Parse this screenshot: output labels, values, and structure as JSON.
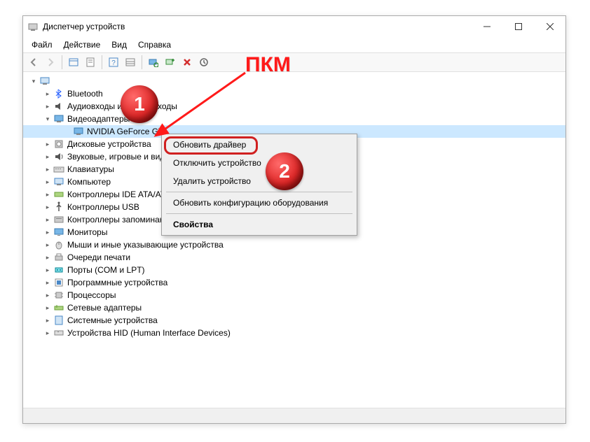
{
  "window": {
    "title": "Диспетчер устройств"
  },
  "menu": {
    "file": "Файл",
    "action": "Действие",
    "view": "Вид",
    "help": "Справка"
  },
  "tree": {
    "root": "",
    "bluetooth": "Bluetooth",
    "audio": "Аудиовходы и аудиовыходы",
    "video": "Видеоадаптеры",
    "nvidia": "NVIDIA GeForce GT",
    "disk": "Дисковые устройства",
    "sound_game": "Звуковые, игровые и видеоустройства",
    "keyboards": "Клавиатуры",
    "computer": "Компьютер",
    "ide": "Контроллеры IDE ATA/ATAPI",
    "usb": "Контроллеры USB",
    "storage": "Контроллеры запоминающих устройств",
    "monitors": "Мониторы",
    "mice": "Мыши и иные указывающие устройства",
    "print": "Очереди печати",
    "ports": "Порты (COM и LPT)",
    "software_devices": "Программные устройства",
    "processors": "Процессоры",
    "network": "Сетевые адаптеры",
    "system": "Системные устройства",
    "hid": "Устройства HID (Human Interface Devices)"
  },
  "context": {
    "update_driver": "Обновить драйвер",
    "disable_device": "Отключить устройство",
    "remove_device": "Удалить устройство",
    "update_config": "Обновить конфигурацию оборудования",
    "properties": "Свойства"
  },
  "annotations": {
    "pkm": "ПКМ",
    "badge1": "1",
    "badge2": "2"
  }
}
